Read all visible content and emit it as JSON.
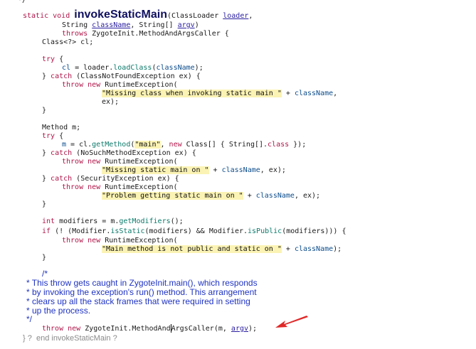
{
  "code": {
    "l0": "*/",
    "l1_kw": "static void",
    "l1_name": "invokeStaticMain",
    "l1_a": "(ClassLoader",
    "l1_b": "loader",
    "l1_c": ",",
    "l2_a": "String",
    "l2_b": "className",
    "l2_c": ", String[]",
    "l2_d": "argv",
    "l2_e": ")",
    "l3_kw": "throws",
    "l3_a": "ZygoteInit.MethodAndArgsCaller {",
    "l4": "Class<?> cl;",
    "l5_kw": "try",
    "l5_a": " {",
    "l6_a": "cl",
    "l6_b": " = loader.",
    "l6_c": "loadClass",
    "l6_d": "(",
    "l6_e": "className",
    "l6_f": ");",
    "l7_a": "} ",
    "l7_kw": "catch",
    "l7_b": " (ClassNotFoundException ex) {",
    "l8_kw": "throw new",
    "l8_a": " RuntimeException(",
    "l9_s": "\"Missing class when invoking static main \"",
    "l9_a": " + ",
    "l9_b": "className",
    "l9_c": ",",
    "l10": "ex);",
    "l11": "}",
    "l12": "Method m;",
    "l13_kw": "try",
    "l13_a": " {",
    "l14_a": "m",
    "l14_b": " = cl.",
    "l14_c": "getMethod",
    "l14_d": "(",
    "l14_s": "\"main\"",
    "l14_e": ", ",
    "l14_kw": "new",
    "l14_f": " Class[] { String[].",
    "l14_kw2": "class",
    "l14_g": " });",
    "l15_a": "} ",
    "l15_kw": "catch",
    "l15_b": " (NoSuchMethodException ex) {",
    "l16_kw": "throw new",
    "l16_a": " RuntimeException(",
    "l17_s": "\"Missing static main on \"",
    "l17_a": " + ",
    "l17_b": "className",
    "l17_c": ", ex);",
    "l18_a": "} ",
    "l18_kw": "catch",
    "l18_b": " (SecurityException ex) {",
    "l19_kw": "throw new",
    "l19_a": " RuntimeException(",
    "l20_s": "\"Problem getting static main on \"",
    "l20_a": " + ",
    "l20_b": "className",
    "l20_c": ", ex);",
    "l21": "}",
    "l22_kw": "int",
    "l22_a": " modifiers = m.",
    "l22_b": "getModifiers",
    "l22_c": "();",
    "l23_kw": "if",
    "l23_a": " (! (Modifier.",
    "l23_b": "isStatic",
    "l23_c": "(modifiers) && Modifier.",
    "l23_d": "isPublic",
    "l23_e": "(modifiers))) {",
    "l24_kw": "throw new",
    "l24_a": " RuntimeException(",
    "l25_s": "\"Main method is not public and static on \"",
    "l25_a": " + ",
    "l25_b": "className",
    "l25_c": ");",
    "l26": "}",
    "l27": "/*",
    "l28": "* This throw gets caught in ZygoteInit.main(), which responds",
    "l29": "* by invoking the exception's run() method. This arrangement",
    "l30": "* clears up all the stack frames that were required in setting",
    "l31": "* up the process.",
    "l32": "*/",
    "l33_kw": "throw new",
    "l33_a": " ZygoteInit.MethodAnd",
    "l33_b": "ArgsCaller(m, ",
    "l33_c": "argv",
    "l33_d": ");",
    "l34": "} ?  end invokeStaticMain ?"
  },
  "colors": {
    "keyword": "#b0164a",
    "field": "#0d4d8c",
    "parameter": "#2a1fa0",
    "method": "#0b7a6a",
    "string_highlight": "#fbf3b4",
    "comment": "#1f33c2",
    "arrow": "#e02828"
  },
  "icons": {
    "annotation": "red-arrow-icon"
  }
}
